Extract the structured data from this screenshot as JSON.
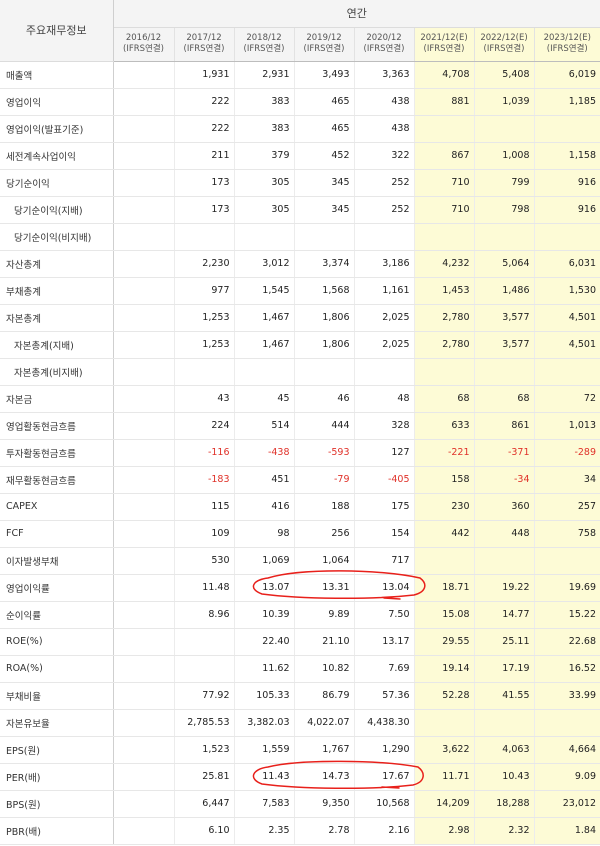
{
  "header": {
    "corner_label": "주요재무정보",
    "period_label": "연간",
    "columns": [
      {
        "year": "2016/12",
        "sub": "(IFRS연결)",
        "estimate": false
      },
      {
        "year": "2017/12",
        "sub": "(IFRS연결)",
        "estimate": false
      },
      {
        "year": "2018/12",
        "sub": "(IFRS연결)",
        "estimate": false
      },
      {
        "year": "2019/12",
        "sub": "(IFRS연결)",
        "estimate": false
      },
      {
        "year": "2020/12",
        "sub": "(IFRS연결)",
        "estimate": false
      },
      {
        "year": "2021/12(E)",
        "sub": "(IFRS연결)",
        "estimate": true
      },
      {
        "year": "2022/12(E)",
        "sub": "(IFRS연결)",
        "estimate": true
      },
      {
        "year": "2023/12(E)",
        "sub": "(IFRS연결)",
        "estimate": true
      }
    ]
  },
  "rows": [
    {
      "label": "매출액",
      "sub": false,
      "values": [
        "",
        "1,931",
        "2,931",
        "3,493",
        "3,363",
        "4,708",
        "5,408",
        "6,019"
      ]
    },
    {
      "label": "영업이익",
      "sub": false,
      "values": [
        "",
        "222",
        "383",
        "465",
        "438",
        "881",
        "1,039",
        "1,185"
      ]
    },
    {
      "label": "영업이익(발표기준)",
      "sub": false,
      "values": [
        "",
        "222",
        "383",
        "465",
        "438",
        "",
        "",
        ""
      ]
    },
    {
      "label": "세전계속사업이익",
      "sub": false,
      "values": [
        "",
        "211",
        "379",
        "452",
        "322",
        "867",
        "1,008",
        "1,158"
      ]
    },
    {
      "label": "당기순이익",
      "sub": false,
      "values": [
        "",
        "173",
        "305",
        "345",
        "252",
        "710",
        "799",
        "916"
      ]
    },
    {
      "label": "당기순이익(지배)",
      "sub": true,
      "values": [
        "",
        "173",
        "305",
        "345",
        "252",
        "710",
        "798",
        "916"
      ]
    },
    {
      "label": "당기순이익(비지배)",
      "sub": true,
      "values": [
        "",
        "",
        "",
        "",
        "",
        "",
        "",
        ""
      ]
    },
    {
      "label": "자산총계",
      "sub": false,
      "sep": true,
      "values": [
        "",
        "2,230",
        "3,012",
        "3,374",
        "3,186",
        "4,232",
        "5,064",
        "6,031"
      ]
    },
    {
      "label": "부채총계",
      "sub": false,
      "values": [
        "",
        "977",
        "1,545",
        "1,568",
        "1,161",
        "1,453",
        "1,486",
        "1,530"
      ]
    },
    {
      "label": "자본총계",
      "sub": false,
      "values": [
        "",
        "1,253",
        "1,467",
        "1,806",
        "2,025",
        "2,780",
        "3,577",
        "4,501"
      ]
    },
    {
      "label": "자본총계(지배)",
      "sub": true,
      "values": [
        "",
        "1,253",
        "1,467",
        "1,806",
        "2,025",
        "2,780",
        "3,577",
        "4,501"
      ]
    },
    {
      "label": "자본총계(비지배)",
      "sub": true,
      "values": [
        "",
        "",
        "",
        "",
        "",
        "",
        "",
        ""
      ]
    },
    {
      "label": "자본금",
      "sub": false,
      "sep": true,
      "values": [
        "",
        "43",
        "45",
        "46",
        "48",
        "68",
        "68",
        "72"
      ]
    },
    {
      "label": "영업활동현금흐름",
      "sub": false,
      "values": [
        "",
        "224",
        "514",
        "444",
        "328",
        "633",
        "861",
        "1,013"
      ]
    },
    {
      "label": "투자활동현금흐름",
      "sub": false,
      "values": [
        "",
        "-116",
        "-438",
        "-593",
        "127",
        "-221",
        "-371",
        "-289"
      ]
    },
    {
      "label": "재무활동현금흐름",
      "sub": false,
      "values": [
        "",
        "-183",
        "451",
        "-79",
        "-405",
        "158",
        "-34",
        "34"
      ]
    },
    {
      "label": "CAPEX",
      "sub": false,
      "values": [
        "",
        "115",
        "416",
        "188",
        "175",
        "230",
        "360",
        "257"
      ]
    },
    {
      "label": "FCF",
      "sub": false,
      "values": [
        "",
        "109",
        "98",
        "256",
        "154",
        "442",
        "448",
        "758"
      ]
    },
    {
      "label": "이자발생부채",
      "sub": false,
      "values": [
        "",
        "530",
        "1,069",
        "1,064",
        "717",
        "",
        "",
        ""
      ]
    },
    {
      "label": "영업이익률",
      "sub": false,
      "values": [
        "",
        "11.48",
        "13.07",
        "13.31",
        "13.04",
        "18.71",
        "19.22",
        "19.69"
      ]
    },
    {
      "label": "순이익률",
      "sub": false,
      "values": [
        "",
        "8.96",
        "10.39",
        "9.89",
        "7.50",
        "15.08",
        "14.77",
        "15.22"
      ]
    },
    {
      "label": "ROE(%)",
      "sub": false,
      "values": [
        "",
        "",
        "22.40",
        "21.10",
        "13.17",
        "29.55",
        "25.11",
        "22.68"
      ]
    },
    {
      "label": "ROA(%)",
      "sub": false,
      "values": [
        "",
        "",
        "11.62",
        "10.82",
        "7.69",
        "19.14",
        "17.19",
        "16.52"
      ]
    },
    {
      "label": "부채비율",
      "sub": false,
      "values": [
        "",
        "77.92",
        "105.33",
        "86.79",
        "57.36",
        "52.28",
        "41.55",
        "33.99"
      ]
    },
    {
      "label": "자본유보율",
      "sub": false,
      "values": [
        "",
        "2,785.53",
        "3,382.03",
        "4,022.07",
        "4,438.30",
        "",
        "",
        ""
      ]
    },
    {
      "label": "EPS(원)",
      "sub": false,
      "sep": true,
      "values": [
        "",
        "1,523",
        "1,559",
        "1,767",
        "1,290",
        "3,622",
        "4,063",
        "4,664"
      ]
    },
    {
      "label": "PER(배)",
      "sub": false,
      "values": [
        "",
        "25.81",
        "11.43",
        "14.73",
        "17.67",
        "11.71",
        "10.43",
        "9.09"
      ]
    },
    {
      "label": "BPS(원)",
      "sub": false,
      "values": [
        "",
        "6,447",
        "7,583",
        "9,350",
        "10,568",
        "14,209",
        "18,288",
        "23,012"
      ]
    },
    {
      "label": "PBR(배)",
      "sub": false,
      "values": [
        "",
        "6.10",
        "2.35",
        "2.78",
        "2.16",
        "2.98",
        "2.32",
        "1.84"
      ]
    }
  ],
  "colors": {
    "estimate_bg": "#fdfbd6",
    "negative": "#e0322a",
    "annotation": "#e8201b"
  }
}
